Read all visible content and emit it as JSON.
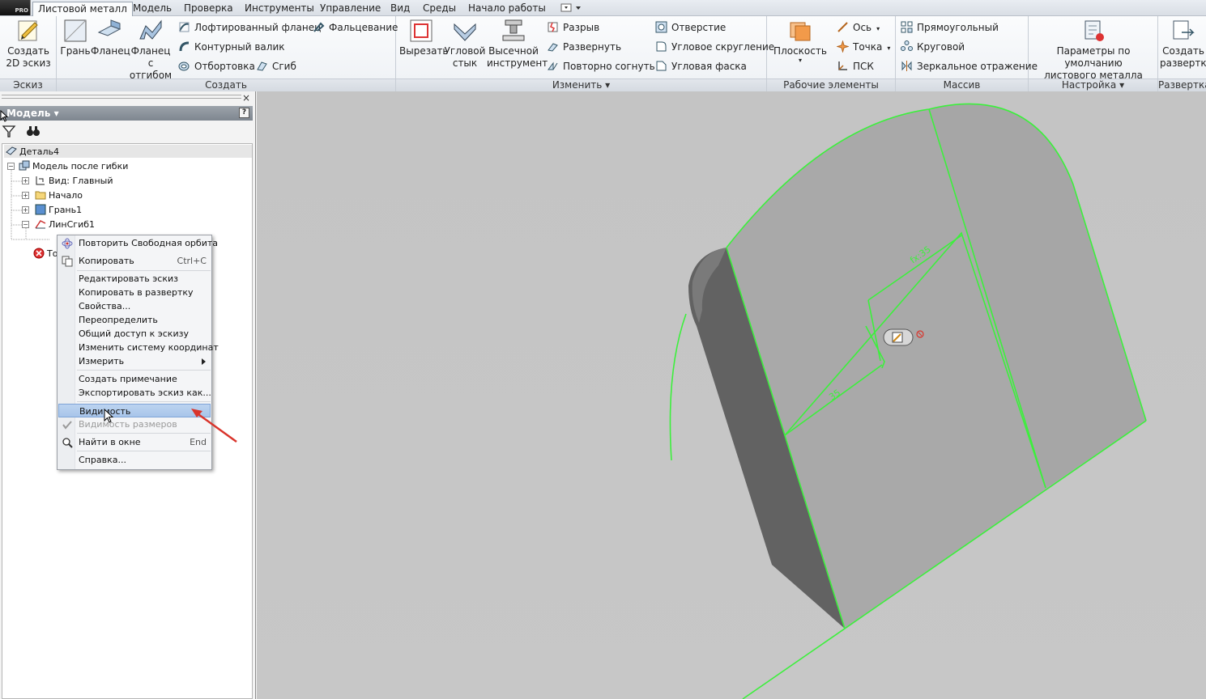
{
  "app": {
    "badge": "PRO"
  },
  "tabs": [
    {
      "label": "Листовой металл",
      "active": true
    },
    {
      "label": "Модель"
    },
    {
      "label": "Проверка"
    },
    {
      "label": "Инструменты"
    },
    {
      "label": "Управление"
    },
    {
      "label": "Вид"
    },
    {
      "label": "Среды"
    },
    {
      "label": "Начало работы"
    }
  ],
  "ribbon": {
    "sketch": {
      "label": "Эскиз",
      "create_sketch": "Создать\n2D эскиз"
    },
    "create": {
      "label": "Создать",
      "face": "Грань",
      "flange": "Фланец",
      "contour_flange": "Фланец с\nотгибом",
      "lofted_flange": "Лофтированный фланец",
      "contour_roll": "Контурный валик",
      "flanging": "Отбортовка",
      "hem": "Фальцевание",
      "bend": "Сгиб"
    },
    "modify": {
      "label": "Изменить",
      "cut": "Вырезать",
      "corner_seam": "Угловой\nстык",
      "punch_tool": "Высечной\nинструмент",
      "rip": "Разрыв",
      "unfold": "Развернуть",
      "refold": "Повторно согнуть",
      "hole": "Отверстие",
      "corner_round": "Угловое скругление",
      "corner_chamfer": "Угловая фаска"
    },
    "work": {
      "label": "Рабочие элементы",
      "plane": "Плоскость",
      "axis": "Ось",
      "point": "Точка",
      "ucs": "ПСК"
    },
    "pattern": {
      "label": "Массив",
      "rectangular": "Прямоугольный",
      "circular": "Круговой",
      "mirror": "Зеркальное отражение"
    },
    "setup": {
      "label": "Настройка",
      "defaults": "Параметры по умолчанию\nлистового металла"
    },
    "flat": {
      "label": "Развертка",
      "create_flat": "Создать\nразвертку"
    }
  },
  "browser": {
    "title": "Модель",
    "close": "×",
    "help": "?",
    "tree": {
      "root": "Деталь4",
      "folded_model": "Модель после гибки",
      "view": "Вид: Главный",
      "origin": "Начало",
      "face1": "Грань1",
      "bend1": "ЛинСгиб1",
      "end_partial": "То"
    }
  },
  "context_menu": {
    "items": [
      {
        "label": "Повторить Свободная орбита",
        "icon": "orbit-icon"
      },
      {
        "label": "Копировать",
        "shortcut": "Ctrl+C",
        "icon": "copy-icon"
      },
      {
        "label": "Редактировать эскиз"
      },
      {
        "label": "Копировать в развертку"
      },
      {
        "label": "Свойства..."
      },
      {
        "label": "Переопределить"
      },
      {
        "label": "Общий доступ к эскизу"
      },
      {
        "label": "Изменить систему координат"
      },
      {
        "label": "Измерить",
        "submenu": true
      },
      {
        "label": "Создать примечание"
      },
      {
        "label": "Экспортировать эскиз как..."
      },
      {
        "label": "Видимость",
        "highlighted": true
      },
      {
        "label": "Видимость размеров",
        "disabled": true,
        "checked": true
      },
      {
        "label": "Найти в окне",
        "shortcut": "End",
        "icon": "find-icon"
      },
      {
        "label": "Справка..."
      }
    ]
  },
  "viewport": {
    "dimensions": [
      "fx:35",
      "35"
    ]
  },
  "colors": {
    "accent_highlight": "#a8c5ea",
    "sketch_green": "#3cf03c",
    "background": "#c6c6c6",
    "annotation_red": "#d9342b"
  }
}
